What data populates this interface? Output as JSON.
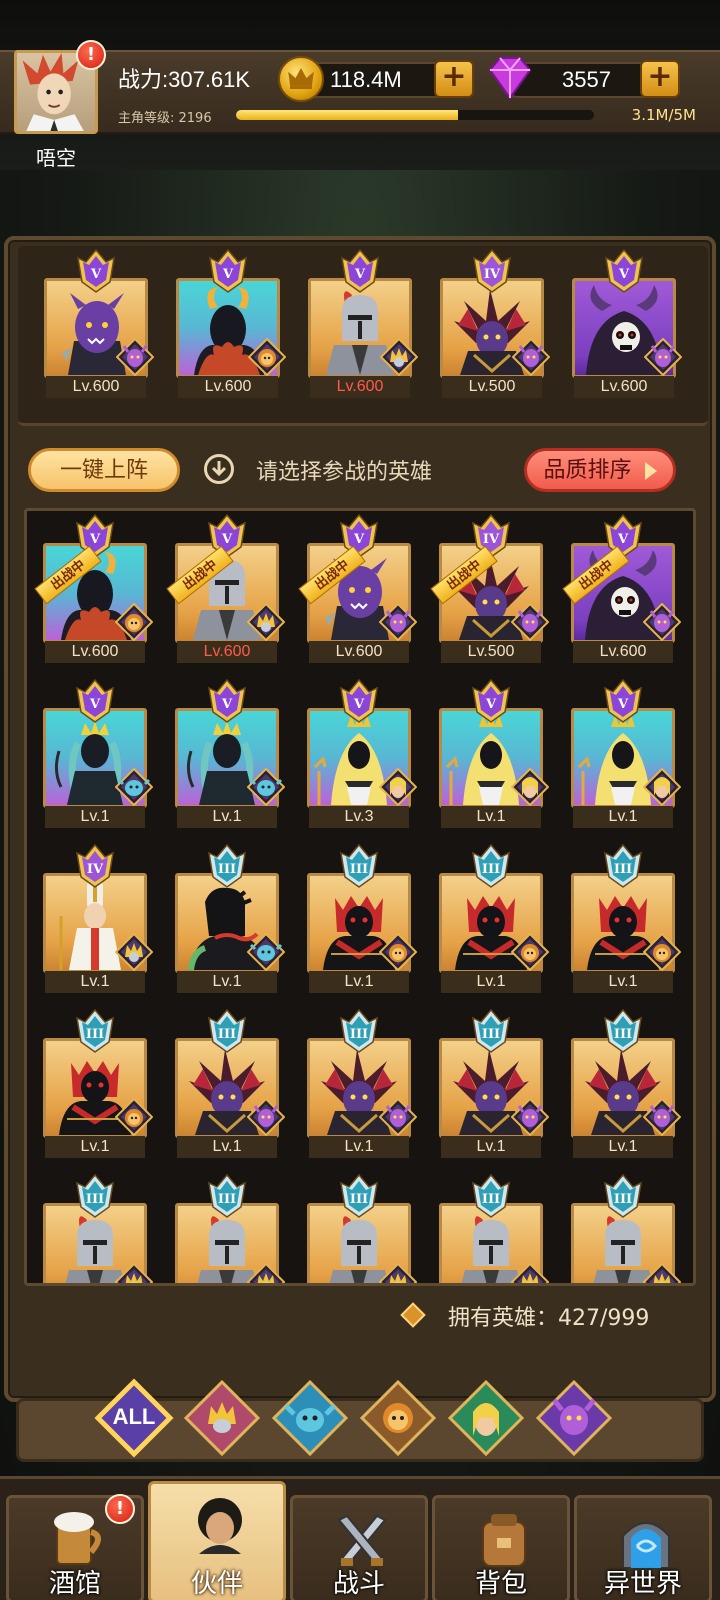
{
  "player": {
    "name": "唔空",
    "power": "战力:307.61K",
    "gold": "118.4M",
    "gems": "3557",
    "level_label": "主角等级: 2196",
    "level_progress": "3.1M/5M",
    "level_fraction": 0.62
  },
  "team": [
    {
      "rank": "V",
      "level": "Lv.600",
      "bg": "gold",
      "hero": "purple-orc",
      "faction": "orc",
      "red": false
    },
    {
      "rank": "V",
      "level": "Lv.600",
      "bg": "cyan",
      "hero": "horned-shadow",
      "faction": "beast",
      "red": false
    },
    {
      "rank": "V",
      "level": "Lv.600",
      "bg": "gold",
      "hero": "knight",
      "faction": "human",
      "red": true
    },
    {
      "rank": "IV",
      "level": "Lv.500",
      "bg": "gold",
      "hero": "spiked-dark",
      "faction": "orc",
      "red": false
    },
    {
      "rank": "V",
      "level": "Lv.600",
      "bg": "purple",
      "hero": "skull-demon",
      "faction": "orc",
      "red": false
    }
  ],
  "actions": {
    "auto_deploy": "一键上阵",
    "hint": "请选择参战的英雄",
    "sort": "品质排序"
  },
  "deployed_label": "出战中",
  "heroes": [
    {
      "rank": "V",
      "level": "Lv.600",
      "bg": "cyan",
      "hero": "horned-shadow",
      "faction": "beast",
      "deployed": true,
      "red": false
    },
    {
      "rank": "V",
      "level": "Lv.600",
      "bg": "gold",
      "hero": "knight",
      "faction": "human",
      "deployed": true,
      "red": true
    },
    {
      "rank": "V",
      "level": "Lv.600",
      "bg": "gold",
      "hero": "purple-orc",
      "faction": "orc",
      "deployed": true,
      "red": false
    },
    {
      "rank": "IV",
      "level": "Lv.500",
      "bg": "gold",
      "hero": "spiked-dark",
      "faction": "orc",
      "deployed": true,
      "red": false
    },
    {
      "rank": "V",
      "level": "Lv.600",
      "bg": "purple",
      "hero": "skull-demon",
      "faction": "orc",
      "deployed": true,
      "red": false
    },
    {
      "rank": "V",
      "level": "Lv.1",
      "bg": "cyan",
      "hero": "naga-queen",
      "faction": "aqua",
      "deployed": false,
      "red": false
    },
    {
      "rank": "V",
      "level": "Lv.1",
      "bg": "cyan",
      "hero": "naga-queen",
      "faction": "aqua",
      "deployed": false,
      "red": false
    },
    {
      "rank": "V",
      "level": "Lv.3",
      "bg": "cyan",
      "hero": "light-king",
      "faction": "elf",
      "deployed": false,
      "red": false
    },
    {
      "rank": "V",
      "level": "Lv.1",
      "bg": "cyan",
      "hero": "light-king",
      "faction": "elf",
      "deployed": false,
      "red": false
    },
    {
      "rank": "V",
      "level": "Lv.1",
      "bg": "cyan",
      "hero": "light-king",
      "faction": "elf",
      "deployed": false,
      "red": false
    },
    {
      "rank": "IV",
      "level": "Lv.1",
      "bg": "gold",
      "hero": "pope",
      "faction": "human",
      "deployed": false,
      "red": false
    },
    {
      "rank": "III",
      "level": "Lv.1",
      "bg": "gold",
      "hero": "shadow-snake",
      "faction": "aqua",
      "deployed": false,
      "red": false
    },
    {
      "rank": "III",
      "level": "Lv.1",
      "bg": "gold",
      "hero": "red-ogre",
      "faction": "beast",
      "deployed": false,
      "red": false
    },
    {
      "rank": "III",
      "level": "Lv.1",
      "bg": "gold",
      "hero": "red-ogre",
      "faction": "beast",
      "deployed": false,
      "red": false
    },
    {
      "rank": "III",
      "level": "Lv.1",
      "bg": "gold",
      "hero": "red-ogre",
      "faction": "beast",
      "deployed": false,
      "red": false
    },
    {
      "rank": "III",
      "level": "Lv.1",
      "bg": "gold",
      "hero": "red-ogre",
      "faction": "beast",
      "deployed": false,
      "red": false
    },
    {
      "rank": "III",
      "level": "Lv.1",
      "bg": "gold",
      "hero": "spiked-dark",
      "faction": "orc",
      "deployed": false,
      "red": false
    },
    {
      "rank": "III",
      "level": "Lv.1",
      "bg": "gold",
      "hero": "spiked-dark",
      "faction": "orc",
      "deployed": false,
      "red": false
    },
    {
      "rank": "III",
      "level": "Lv.1",
      "bg": "gold",
      "hero": "spiked-dark",
      "faction": "orc",
      "deployed": false,
      "red": false
    },
    {
      "rank": "III",
      "level": "Lv.1",
      "bg": "gold",
      "hero": "spiked-dark",
      "faction": "orc",
      "deployed": false,
      "red": false
    },
    {
      "rank": "III",
      "level": "",
      "bg": "gold",
      "hero": "knight",
      "faction": "human",
      "deployed": false,
      "red": false
    },
    {
      "rank": "III",
      "level": "",
      "bg": "gold",
      "hero": "knight",
      "faction": "human",
      "deployed": false,
      "red": false
    },
    {
      "rank": "III",
      "level": "",
      "bg": "gold",
      "hero": "knight",
      "faction": "human",
      "deployed": false,
      "red": false
    },
    {
      "rank": "III",
      "level": "",
      "bg": "gold",
      "hero": "knight",
      "faction": "human",
      "deployed": false,
      "red": false
    },
    {
      "rank": "III",
      "level": "",
      "bg": "gold",
      "hero": "knight",
      "faction": "human",
      "deployed": false,
      "red": false
    }
  ],
  "owned": "拥有英雄：427/999",
  "filters": [
    {
      "label": "ALL",
      "icon": "all-filter",
      "active": true
    },
    {
      "label": "",
      "icon": "human-faction-icon",
      "active": false
    },
    {
      "label": "",
      "icon": "aqua-faction-icon",
      "active": false
    },
    {
      "label": "",
      "icon": "beast-faction-icon",
      "active": false
    },
    {
      "label": "",
      "icon": "elf-faction-icon",
      "active": false
    },
    {
      "label": "",
      "icon": "orc-faction-icon",
      "active": false
    }
  ],
  "nav": [
    {
      "label": "酒馆",
      "icon": "tavern-icon",
      "active": false,
      "alert": "!"
    },
    {
      "label": "伙伴",
      "icon": "partner-icon",
      "active": true,
      "alert": ""
    },
    {
      "label": "战斗",
      "icon": "battle-icon",
      "active": false,
      "alert": ""
    },
    {
      "label": "背包",
      "icon": "backpack-icon",
      "active": false,
      "alert": ""
    },
    {
      "label": "异世界",
      "icon": "portal-icon",
      "active": false,
      "alert": ""
    }
  ],
  "colors": {
    "gold_frame": "#b88a43",
    "rank_purple": "#8b46d8",
    "rank_teal": "#2f9fb5",
    "level_red": "#ff5a4a"
  }
}
